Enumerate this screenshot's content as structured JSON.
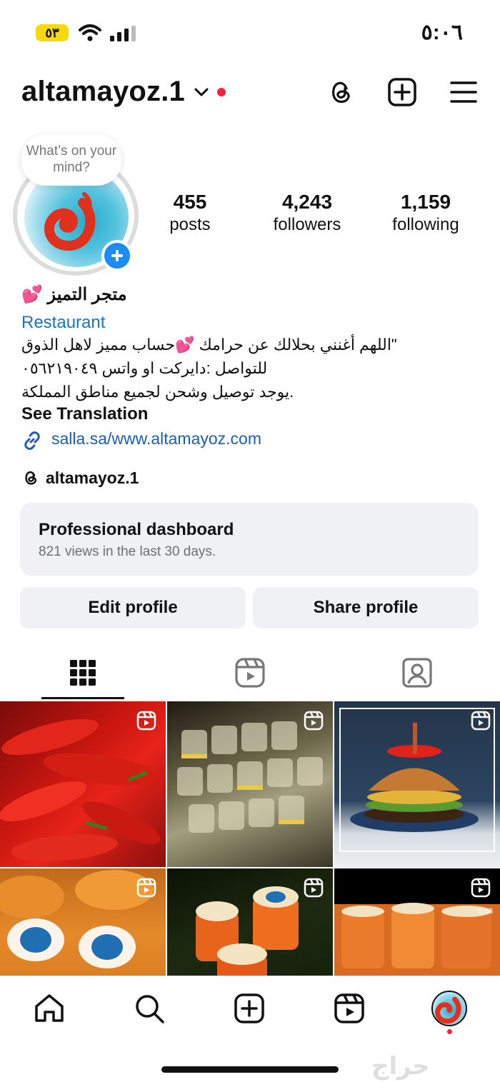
{
  "status_bar": {
    "battery": "٥٣",
    "time": "٥:٠٦"
  },
  "header": {
    "username": "altamayoz.1",
    "icons": [
      "threads-icon",
      "create-icon",
      "menu-icon"
    ]
  },
  "profile": {
    "note_bubble": "What’s on your mind?",
    "stats": [
      {
        "value": "455",
        "label": "posts"
      },
      {
        "value": "4,243",
        "label": "followers"
      },
      {
        "value": "1,159",
        "label": "following"
      }
    ],
    "name": "متجر التميز 💕",
    "category": "Restaurant",
    "bio_lines": [
      "\"اللهم أغنني بحلالك عن حرامك 💕حساب مميز لاهل الذوق",
      "للتواصل :دايركت او واتس ٠٥٦٢١٩٠٤٩",
      ".يوجد توصيل وشحن لجميع مناطق المملكة"
    ],
    "see_translation": "See Translation",
    "link": "salla.sa/www.altamayoz.com",
    "threads_handle": "altamayoz.1"
  },
  "dashboard": {
    "title": "Professional dashboard",
    "subtitle": "821 views in the last 30 days."
  },
  "actions": {
    "edit": "Edit profile",
    "share": "Share profile"
  },
  "tabs": [
    "grid-icon",
    "reels-icon",
    "tagged-icon"
  ],
  "grid": {
    "posts": [
      {
        "subject": "red chili peppers",
        "reel": true
      },
      {
        "subject": "jars stacked",
        "reel": true
      },
      {
        "subject": "burger with pepper",
        "reel": true
      },
      {
        "subject": "sauce containers",
        "reel": true
      },
      {
        "subject": "orange jars",
        "reel": true
      },
      {
        "subject": "jar lids",
        "reel": true,
        "duration": "0:08"
      }
    ]
  },
  "bottom_nav": [
    "home-icon",
    "search-icon",
    "create-icon",
    "reels-icon",
    "profile-avatar"
  ],
  "watermark": "حراج",
  "colors": {
    "accent_blue": "#1d8cf0",
    "link_blue": "#1a5fb4",
    "notification_red": "#ff1f3d",
    "button_bg": "#eff1f4"
  }
}
